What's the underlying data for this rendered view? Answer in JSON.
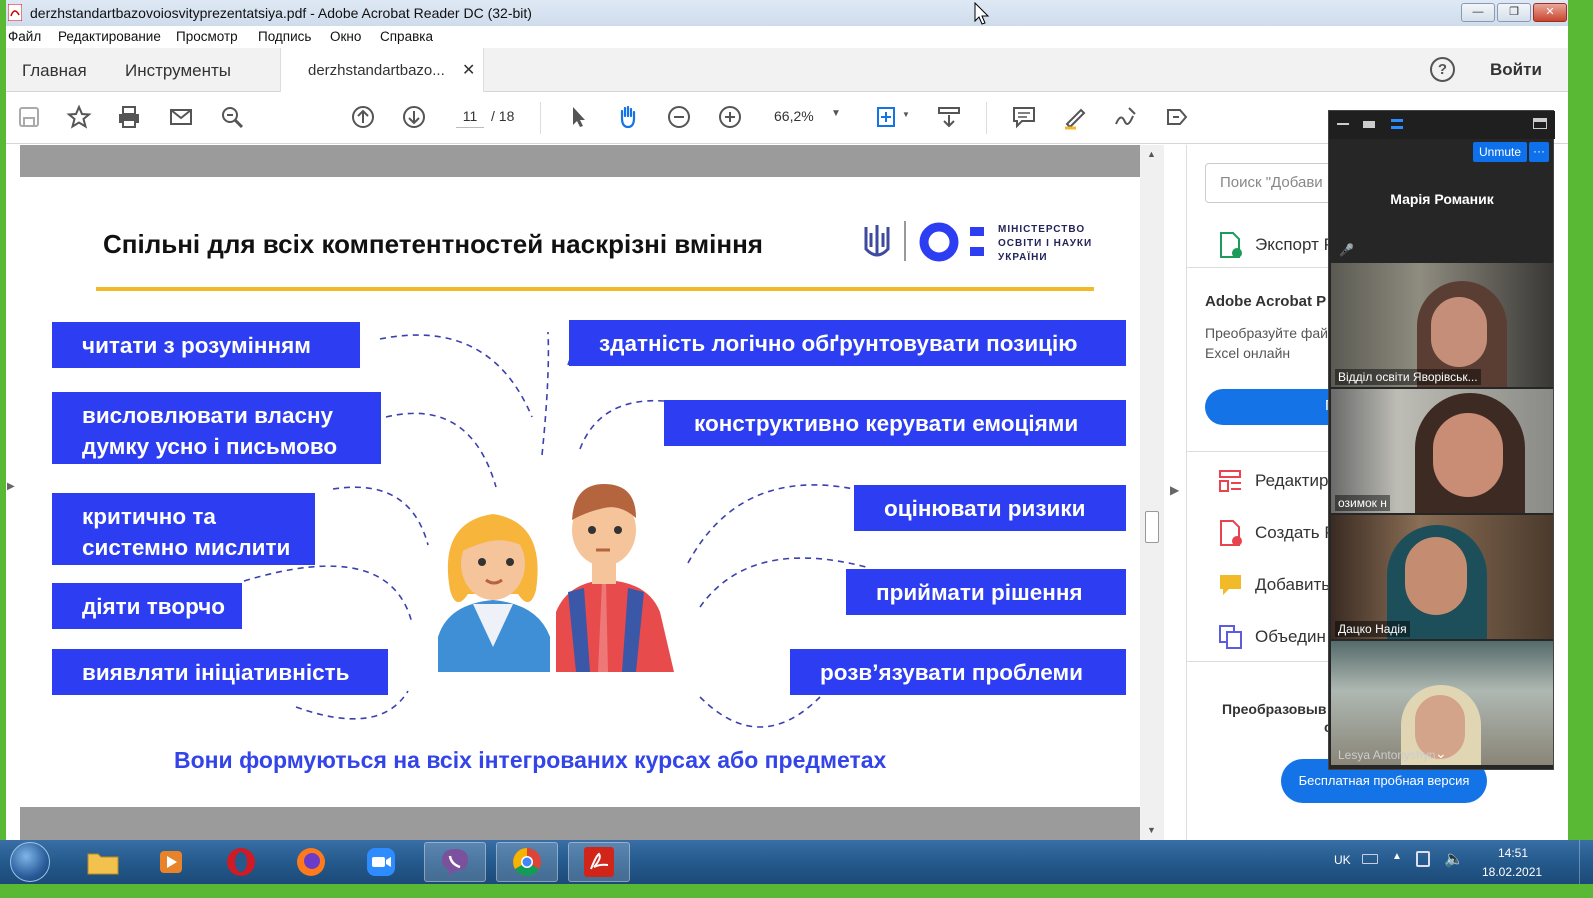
{
  "window": {
    "title": "derzhstandartbazovoiosvityprezentatsiya.pdf - Adobe Acrobat Reader DC (32-bit)"
  },
  "menu": [
    "Файл",
    "Редактирование",
    "Просмотр",
    "Подпись",
    "Окно",
    "Справка"
  ],
  "tabs": {
    "home": "Главная",
    "tools": "Инструменты",
    "document": "derzhstandartbazo...",
    "help": "?",
    "signin": "Войти"
  },
  "toolbar": {
    "page_current": "11",
    "page_total": "/ 18",
    "zoom": "66,2%"
  },
  "slide": {
    "title": "Спільні для всіх компетентностей наскрізні вміння",
    "logo": {
      "line1": "МІНІСТЕРСТВО",
      "line2": "ОСВІТИ І НАУКИ",
      "line3": "УКРАЇНИ"
    },
    "left_skills": [
      {
        "line1": "читати з розумінням",
        "line2": ""
      },
      {
        "line1": "висловлювати власну",
        "line2": "думку усно і письмово"
      },
      {
        "line1": "критично та",
        "line2": "системно мислити"
      },
      {
        "line1": "діяти творчо",
        "line2": ""
      },
      {
        "line1": "виявляти ініціативність",
        "line2": ""
      }
    ],
    "right_skills": [
      "здатність логічно обґрунтовувати позицію",
      "конструктивно керувати емоціями",
      "оцінювати ризики",
      "приймати рішення",
      "розв’язувати проблеми"
    ],
    "footer": "Вони формуються на всіх інтегрованих курсах або предметах"
  },
  "right_panel": {
    "search_placeholder": "Поиск \"Добави",
    "export": "Экспорт P",
    "promo_title": "Adobe Acrobat P",
    "promo_text1": "Преобразуйте фай",
    "promo_text2": "Excel онлайн",
    "promo_button": "П",
    "edit": "Редактир",
    "create": "Создать P",
    "add": "Добавить",
    "combine": "Объедин",
    "convert1": "Преобразовыв",
    "convert2": "с",
    "trial": "Бесплатная пробная версия"
  },
  "zoom_call": {
    "unmute": "Unmute",
    "more": "···",
    "speaker": "Марія  Романик",
    "participants": [
      "Відділ освіти Яворівськ...",
      "озимок н",
      "Дацко Надія",
      "Lesya Antonyshyn"
    ]
  },
  "taskbar": {
    "lang": "UK",
    "time": "14:51",
    "date": "18.02.2021"
  },
  "colors": {
    "slide_box": "#2d3ef2",
    "accent_line": "#f2b928",
    "acrobat_blue": "#1473e6",
    "zoom_blue": "#0e71eb",
    "desktop_green": "#5ab934"
  }
}
